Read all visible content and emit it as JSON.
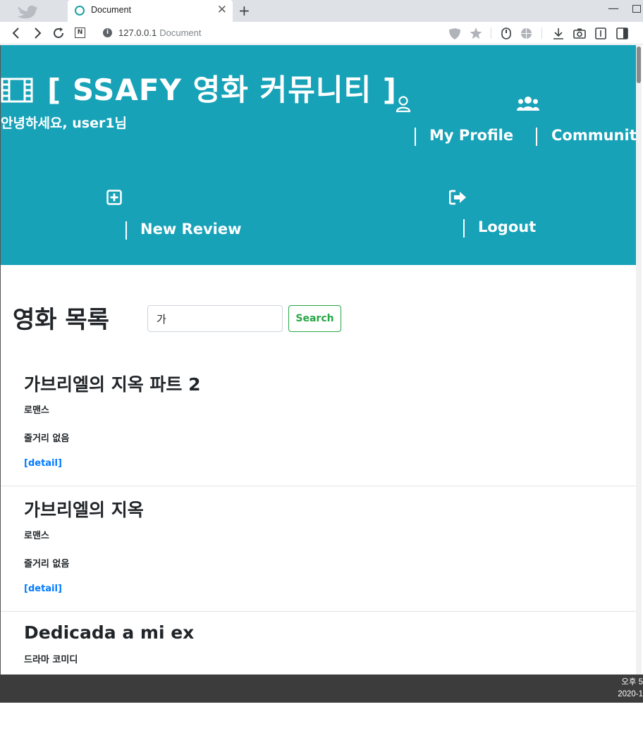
{
  "browser": {
    "tab_title": "Document",
    "tab_close": "✕",
    "new_tab": "+",
    "address_host": "127.0.0.1",
    "address_page": "Document",
    "nav_back": "‹",
    "nav_forward": "›",
    "nav_reload": "↻",
    "n_icon": "N",
    "info_icon": "i"
  },
  "header": {
    "brand": "[ SSAFY 영화 커뮤니티 ]",
    "greeting": "안녕하세요, user1님",
    "nav": [
      {
        "label": "My Profile",
        "icon": "user-icon"
      },
      {
        "label": "Community",
        "icon": "users-icon"
      },
      {
        "label": "New Review",
        "icon": "plus-square-icon"
      },
      {
        "label": "Logout",
        "icon": "sign-out-icon"
      }
    ]
  },
  "main": {
    "heading": "영화 목록",
    "search": {
      "value": "가",
      "button": "Search"
    },
    "movies": [
      {
        "title": "가브리엘의 지옥 파트 2",
        "genre": "로맨스",
        "plot": "줄거리 없음",
        "link": "[detail]"
      },
      {
        "title": "가브리엘의 지옥",
        "genre": "로맨스",
        "plot": "줄거리 없음",
        "link": "[detail]"
      },
      {
        "title": "Dedicada a mi ex",
        "genre": "드라마 코미디"
      }
    ]
  },
  "taskbar": {
    "time": "오후 5",
    "date": "2020-1"
  },
  "colors": {
    "header_bg": "#17a2b8",
    "search_button": "#28a745",
    "link": "#007bff"
  }
}
